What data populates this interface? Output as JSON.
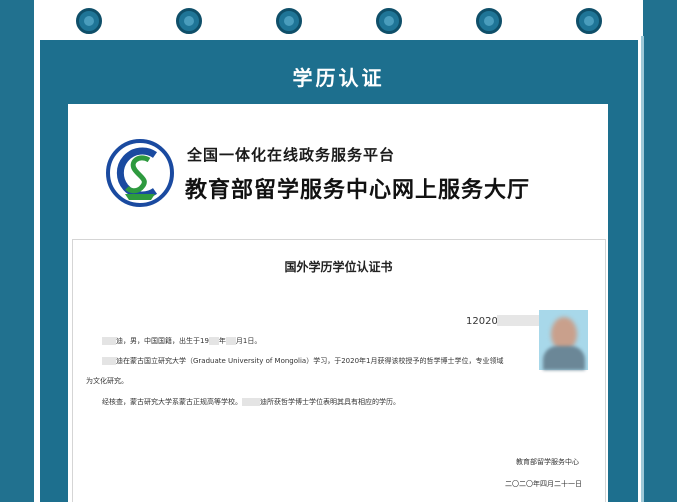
{
  "page": {
    "title": "学历认证"
  },
  "brand": {
    "line1": "全国一体化在线政务服务平台",
    "line2": "教育部留学服务中心网上服务大厅"
  },
  "certificate": {
    "title": "国外学历学位认证书",
    "number_prefix": "12020",
    "line1_a": "迪，男，中国国籍，出生于19",
    "line1_b": "年",
    "line1_c": "月1日。",
    "line2_a": "迪在蒙古国立研究大学（Graduate University of Mongolia）学习，于2020年1月获得该校授予的哲学博士学位，专业领域",
    "line3": "为文化研究。",
    "line4_a": "经核查，蒙古研究大学系蒙古正规高等学校。",
    "line4_b": "迪所获哲学博士学位表明其具有相应的学历。",
    "issuer": "教育部留学服务中心",
    "date": "二〇二〇年四月二十一日"
  },
  "colors": {
    "frame": "#21718f",
    "card": "#1d6f8e",
    "ring": "#1f7597"
  }
}
